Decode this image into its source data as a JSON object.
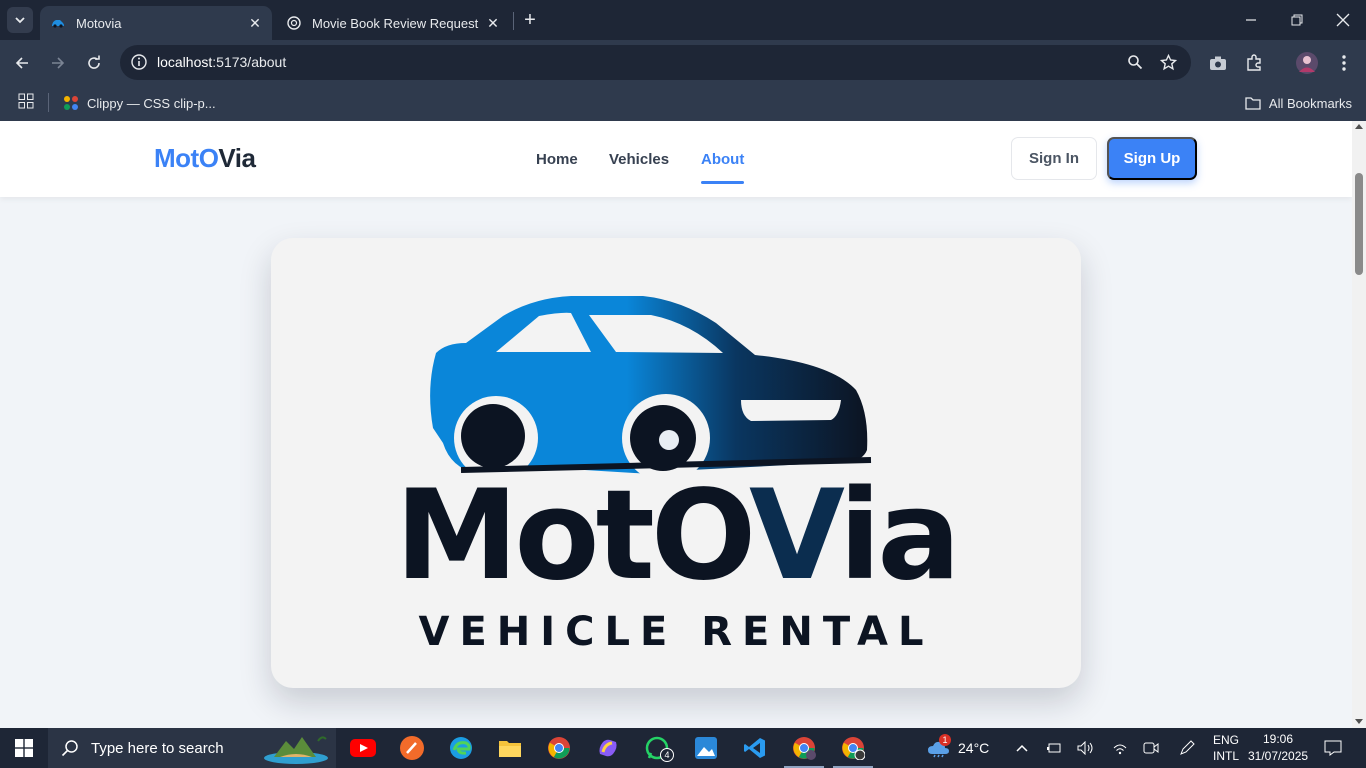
{
  "browser": {
    "tabs": [
      {
        "title": "Motovia",
        "active": true
      },
      {
        "title": "Movie Book Review Request",
        "active": false
      }
    ],
    "address": {
      "host": "localhost",
      "path": ":5173/about"
    },
    "bookmarks": {
      "item": "Clippy — CSS clip-p...",
      "all": "All Bookmarks"
    }
  },
  "site": {
    "brand_part1": "MotO",
    "brand_part2": "Via",
    "nav": [
      {
        "label": "Home",
        "active": false
      },
      {
        "label": "Vehicles",
        "active": false
      },
      {
        "label": "About",
        "active": true
      }
    ],
    "signin_label": "Sign In",
    "signup_label": "Sign Up",
    "logo": {
      "word_part1": "MotO",
      "word_part2": "V",
      "word_part3": "ia",
      "tagline": "VEHICLE RENTAL",
      "colors": {
        "primary_blue": "#0a86d9",
        "dark": "#0c1422"
      }
    },
    "accent_color": "#3b82f6"
  },
  "taskbar": {
    "search_placeholder": "Type here to search",
    "weather": "24°C",
    "lang_line1": "ENG",
    "lang_line2": "INTL",
    "time": "19:06",
    "date": "31/07/2025",
    "whatsapp_badge": "4",
    "weather_badge": "1"
  }
}
